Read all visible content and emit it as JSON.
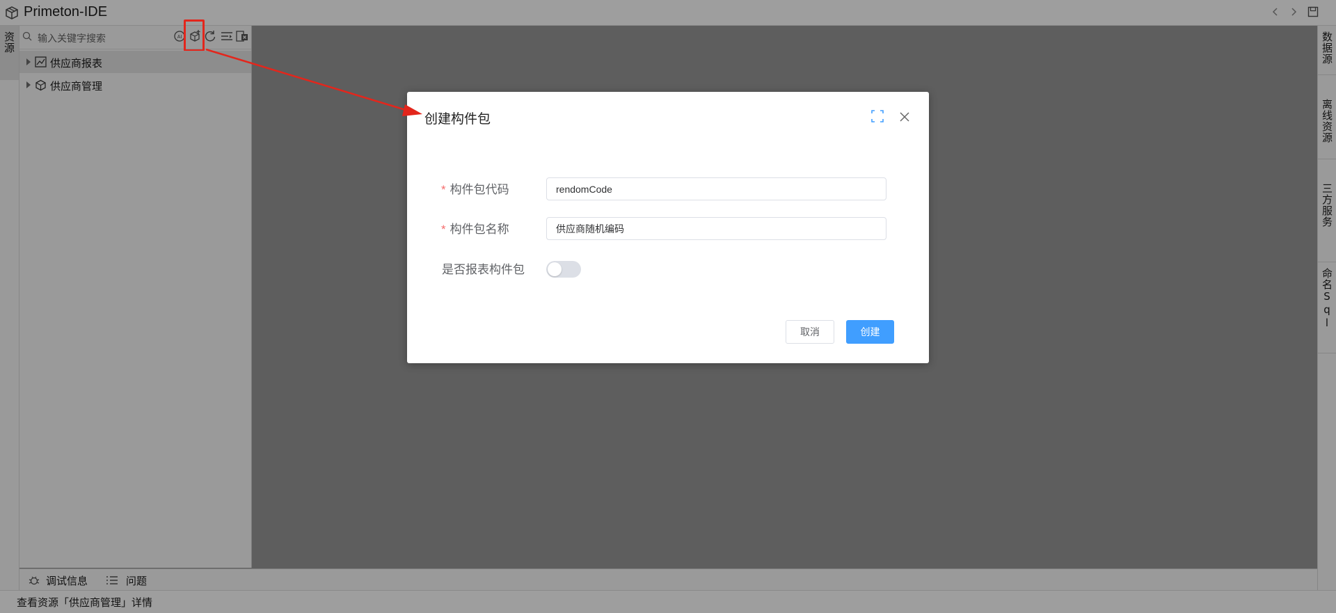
{
  "app": {
    "title": "Primeton-IDE"
  },
  "titlebar": {
    "icons": [
      "chevron-left-icon",
      "chevron-right-icon",
      "save-icon"
    ]
  },
  "left_strip": {
    "tab_label": "资源"
  },
  "explorer": {
    "search_placeholder": "输入关键字搜索",
    "toolbar_icons": [
      "ai-icon",
      "new-package-icon",
      "refresh-icon",
      "collapse-icon",
      "export-icon"
    ],
    "tree": [
      {
        "label": "供应商报表",
        "icon": "chart-icon",
        "selected": true
      },
      {
        "label": "供应商管理",
        "icon": "cube-icon",
        "selected": false
      }
    ]
  },
  "right_strip": {
    "tabs": [
      "数据源",
      "离线资源",
      "三方服务",
      "命名Sql"
    ]
  },
  "bottom_panel": {
    "tabs": [
      {
        "label": "调试信息",
        "icon": "debug-icon"
      },
      {
        "label": "问题",
        "icon": "list-icon"
      }
    ]
  },
  "status_bar": {
    "text": "查看资源「供应商管理」详情"
  },
  "dialog": {
    "title": "创建构件包",
    "fields": [
      {
        "label": "构件包代码",
        "required": true,
        "value": "rendomCode"
      },
      {
        "label": "构件包名称",
        "required": true,
        "value": "供应商随机编码"
      },
      {
        "label": "是否报表构件包",
        "required": false,
        "toggle_on": false
      }
    ],
    "required_mark": "*",
    "cancel_label": "取消",
    "create_label": "创建"
  },
  "colors": {
    "primary": "#409eff",
    "required": "#f56c6c",
    "highlight": "#e3261c",
    "overlay": "#5e5e5e"
  }
}
